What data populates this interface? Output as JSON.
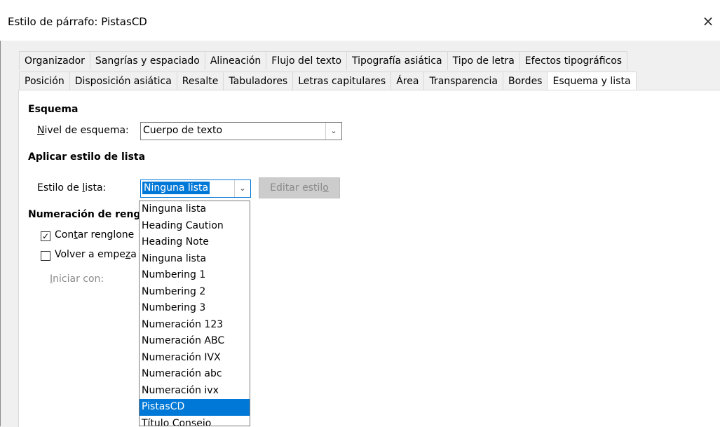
{
  "window": {
    "title": "Estilo de párrafo: PistasCD",
    "close_glyph": "×"
  },
  "tabs_row1": [
    "Organizador",
    "Sangrías y espaciado",
    "Alineación",
    "Flujo del texto",
    "Tipografía asiática",
    "Tipo de letra",
    "Efectos tipográficos"
  ],
  "tabs_row2": [
    "Posición",
    "Disposición asiática",
    "Resalte",
    "Tabuladores",
    "Letras capitulares",
    "Área",
    "Transparencia",
    "Bordes",
    "Esquema y lista"
  ],
  "active_tab": "Esquema y lista",
  "accent_color": "#e81123",
  "selection_color": "#0078d7",
  "outline": {
    "section_title": "Esquema",
    "level_label": "Nivel de esquema:",
    "level_value": "Cuerpo de texto"
  },
  "list_style": {
    "section_title": "Aplicar estilo de lista",
    "label": "Estilo de lista:",
    "value": "Ninguna lista",
    "edit_button": "Editar estilo"
  },
  "line_numbering": {
    "section_title": "Numeración de rengl",
    "count_lines": {
      "label": "Contar renglone",
      "checked": true,
      "check_glyph": "✓"
    },
    "restart": {
      "label": "Volver a empeza",
      "checked": false
    },
    "start_with": "Iniciar con:"
  },
  "dropdown": {
    "items": [
      "Ninguna lista",
      "Heading Caution",
      "Heading Note",
      "Ninguna lista",
      "Numbering 1",
      "Numbering 2",
      "Numbering 3",
      "Numeración 123",
      "Numeración ABC",
      "Numeración IVX",
      "Numeración abc",
      "Numeración ivx",
      "PistasCD",
      "Título Consejo"
    ],
    "selected": "PistasCD"
  },
  "icons": {
    "combo_arrow": "﹀",
    "close": "close-icon"
  }
}
